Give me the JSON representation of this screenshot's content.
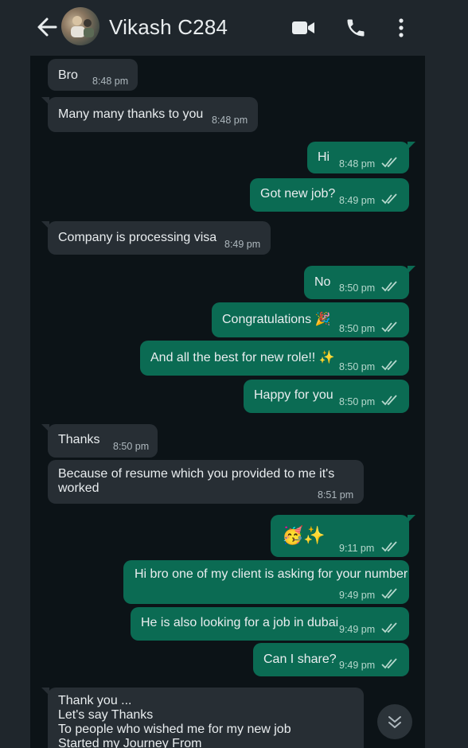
{
  "header": {
    "contact_name": "Vikash C284",
    "icons": [
      "back-arrow-icon",
      "avatar",
      "video-call-icon",
      "voice-call-icon",
      "more-options-icon"
    ]
  },
  "messages": [
    {
      "dir": "in",
      "text": "Bro",
      "time": "8:48 pm"
    },
    {
      "dir": "in",
      "text": "Many many thanks to you",
      "time": "8:48 pm"
    },
    {
      "dir": "out",
      "text": "Hi",
      "time": "8:48 pm",
      "status": "read"
    },
    {
      "dir": "out",
      "text": "Got new job?",
      "time": "8:49 pm",
      "status": "read"
    },
    {
      "dir": "in",
      "text": "Company is processing visa",
      "time": "8:49 pm"
    },
    {
      "dir": "out",
      "text": "No",
      "time": "8:50 pm",
      "status": "read"
    },
    {
      "dir": "out",
      "text": "Congratulations 🎉",
      "time": "8:50 pm",
      "status": "read"
    },
    {
      "dir": "out",
      "text": "And all the best for new role!! ✨",
      "time": "8:50 pm",
      "status": "read"
    },
    {
      "dir": "out",
      "text": "Happy for you",
      "time": "8:50 pm",
      "status": "read"
    },
    {
      "dir": "in",
      "text": "Thanks",
      "time": "8:50 pm"
    },
    {
      "dir": "in",
      "text_lines": [
        "Because of resume which you provided to me it's",
        "worked"
      ],
      "time": "8:51 pm"
    },
    {
      "dir": "out",
      "text": "🥳✨",
      "time": "9:11 pm",
      "status": "read"
    },
    {
      "dir": "out",
      "text": "Hi bro one of my client is asking for your number",
      "time": "9:49 pm",
      "status": "read"
    },
    {
      "dir": "out",
      "text": "He is also looking for a job in dubai",
      "time": "9:49 pm",
      "status": "read"
    },
    {
      "dir": "out",
      "text": "Can I share?",
      "time": "9:49 pm",
      "status": "read"
    },
    {
      "dir": "in",
      "text_lines": [
        "Thank you ...",
        "Let's say Thanks",
        "To people who wished me for my new job",
        "Started my Journey From"
      ]
    }
  ],
  "colors": {
    "incoming_bubble": "#272e34",
    "outgoing_bubble": "#0b6b53",
    "chat_background": "#0c1317",
    "header_background": "#1f262c",
    "read_ticks": "#b6d8cd"
  }
}
